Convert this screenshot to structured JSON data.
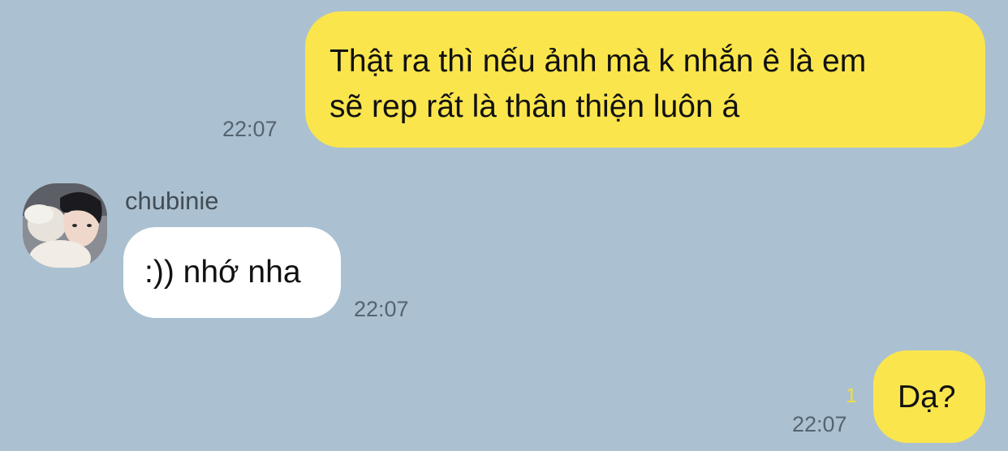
{
  "messages": [
    {
      "direction": "outgoing",
      "text": "Thật ra thì nếu ảnh mà k nhắn ê là em\nsẽ rep rất là thân thiện luôn á",
      "time": "22:07"
    },
    {
      "direction": "incoming",
      "sender": "chubinie",
      "avatar_icon": "user-avatar-photo",
      "text": ":)) nhớ nha",
      "time": "22:07"
    },
    {
      "direction": "outgoing",
      "text": "Dạ?",
      "time": "22:07",
      "unread_count": "1"
    }
  ],
  "colors": {
    "background": "#abc1d1",
    "outgoing_bubble": "#fae54d",
    "incoming_bubble": "#ffffff",
    "unread_count": "#f2dc3b",
    "timestamp": "#556370"
  }
}
